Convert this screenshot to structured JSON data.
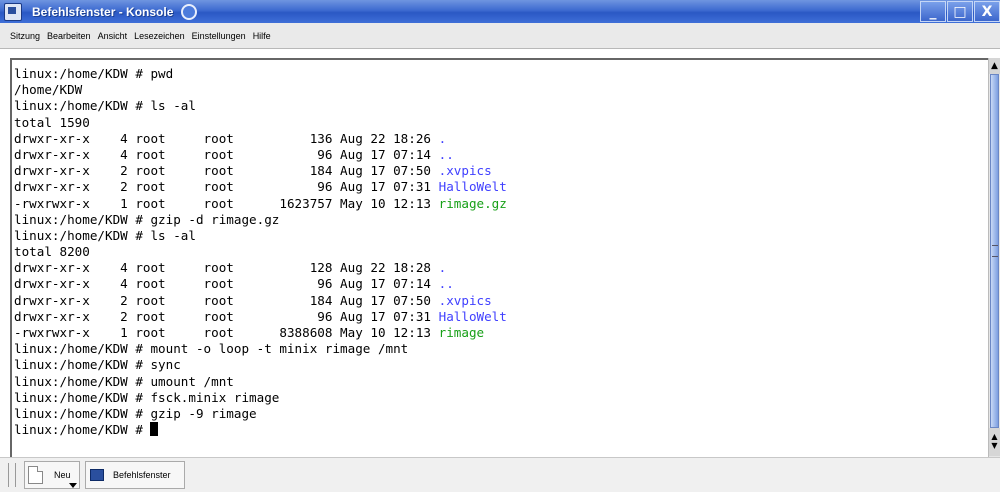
{
  "window": {
    "title": "Befehlsfenster - Konsole",
    "buttons": {
      "minimize": "_",
      "maximize": "□",
      "close": "X"
    }
  },
  "menu": {
    "items": [
      "Sitzung",
      "Bearbeiten",
      "Ansicht",
      "Lesezeichen",
      "Einstellungen",
      "Hilfe"
    ]
  },
  "terminal": {
    "lines": [
      [
        {
          "t": "linux:/home/KDW # pwd"
        }
      ],
      [
        {
          "t": "/home/KDW"
        }
      ],
      [
        {
          "t": "linux:/home/KDW # ls -al"
        }
      ],
      [
        {
          "t": "total 1590"
        }
      ],
      [
        {
          "t": "drwxr-xr-x    4 root     root          136 Aug 22 18:26 "
        },
        {
          "t": ".",
          "c": "blue"
        }
      ],
      [
        {
          "t": "drwxr-xr-x    4 root     root           96 Aug 17 07:14 "
        },
        {
          "t": "..",
          "c": "blue"
        }
      ],
      [
        {
          "t": "drwxr-xr-x    2 root     root          184 Aug 17 07:50 "
        },
        {
          "t": ".xvpics",
          "c": "blue"
        }
      ],
      [
        {
          "t": "drwxr-xr-x    2 root     root           96 Aug 17 07:31 "
        },
        {
          "t": "HalloWelt",
          "c": "blue"
        }
      ],
      [
        {
          "t": "-rwxrwxr-x    1 root     root      1623757 May 10 12:13 "
        },
        {
          "t": "rimage.gz",
          "c": "green"
        }
      ],
      [
        {
          "t": "linux:/home/KDW # gzip -d rimage.gz"
        }
      ],
      [
        {
          "t": "linux:/home/KDW # ls -al"
        }
      ],
      [
        {
          "t": "total 8200"
        }
      ],
      [
        {
          "t": "drwxr-xr-x    4 root     root          128 Aug 22 18:28 "
        },
        {
          "t": ".",
          "c": "blue"
        }
      ],
      [
        {
          "t": "drwxr-xr-x    4 root     root           96 Aug 17 07:14 "
        },
        {
          "t": "..",
          "c": "blue"
        }
      ],
      [
        {
          "t": "drwxr-xr-x    2 root     root          184 Aug 17 07:50 "
        },
        {
          "t": ".xvpics",
          "c": "blue"
        }
      ],
      [
        {
          "t": "drwxr-xr-x    2 root     root           96 Aug 17 07:31 "
        },
        {
          "t": "HalloWelt",
          "c": "blue"
        }
      ],
      [
        {
          "t": "-rwxrwxr-x    1 root     root      8388608 May 10 12:13 "
        },
        {
          "t": "rimage",
          "c": "green"
        }
      ],
      [
        {
          "t": "linux:/home/KDW # mount -o loop -t minix rimage /mnt"
        }
      ],
      [
        {
          "t": "linux:/home/KDW # sync"
        }
      ],
      [
        {
          "t": "linux:/home/KDW # umount /mnt"
        }
      ],
      [
        {
          "t": "linux:/home/KDW # fsck.minix rimage"
        }
      ],
      [
        {
          "t": "linux:/home/KDW # gzip -9 rimage"
        }
      ],
      [
        {
          "t": "linux:/home/KDW # "
        },
        {
          "cursor": true
        }
      ]
    ],
    "colors": {
      "blue": "#4040ff",
      "green": "#18a018",
      "text": "#000000"
    }
  },
  "tabbar": {
    "new_label": "Neu",
    "session_label": "Befehlsfenster"
  },
  "icons": {
    "app": "konsole-icon",
    "sticky": "sticky-icon",
    "new": "new-document-icon",
    "session": "terminal-icon"
  }
}
